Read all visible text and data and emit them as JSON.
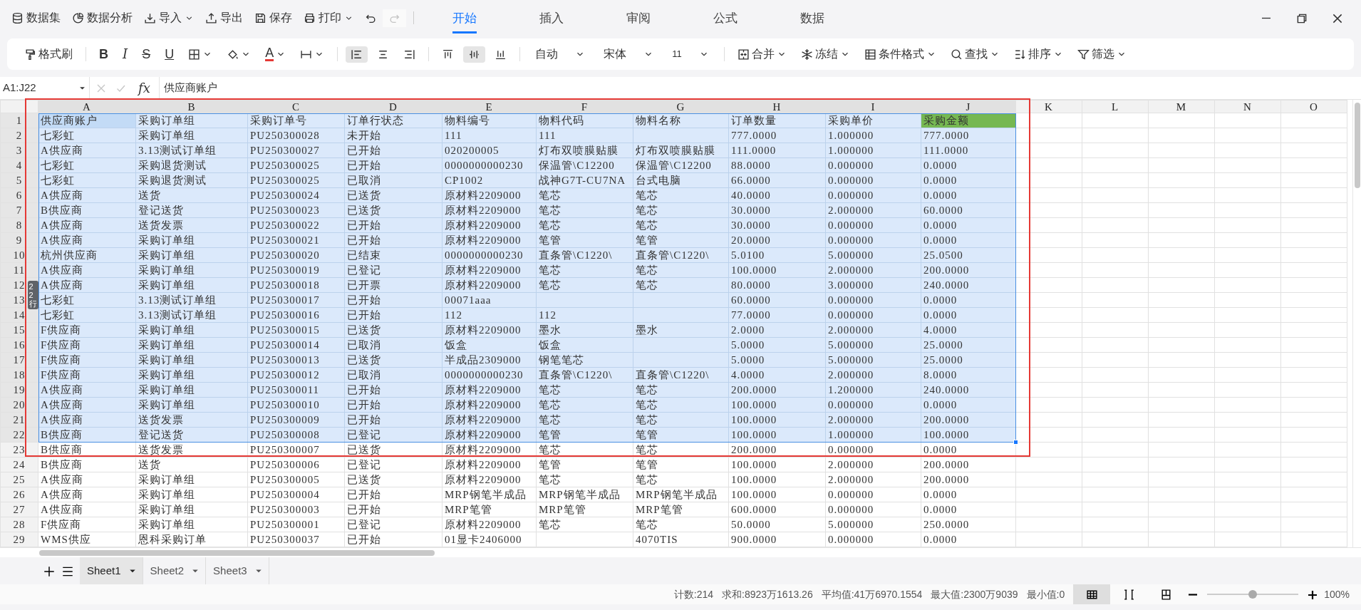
{
  "quick_actions": [
    {
      "kind": "database",
      "label": "数据集",
      "dropdown": false
    },
    {
      "kind": "pie",
      "label": "数据分析",
      "dropdown": false
    },
    {
      "kind": "download",
      "label": "导入",
      "dropdown": true
    },
    {
      "kind": "upload",
      "label": "导出",
      "dropdown": false
    },
    {
      "kind": "save",
      "label": "保存",
      "dropdown": false
    },
    {
      "kind": "print",
      "label": "打印",
      "dropdown": true
    },
    {
      "kind": "undo",
      "disabled": false
    },
    {
      "kind": "redo",
      "disabled": true
    }
  ],
  "tabs": [
    {
      "label": "开始",
      "selected": true
    },
    {
      "label": "插入",
      "selected": false
    },
    {
      "label": "审阅",
      "selected": false
    },
    {
      "label": "公式",
      "selected": false
    },
    {
      "label": "数据",
      "selected": false
    }
  ],
  "toolbar": [
    {
      "kind": "brush",
      "label": "格式刷",
      "dropdown": false,
      "selected": false
    },
    {
      "kind": "separator"
    },
    {
      "kind": "bold",
      "text": "B",
      "dropdown": false,
      "selected": false
    },
    {
      "kind": "italic",
      "text": "I",
      "dropdown": false,
      "selected": false
    },
    {
      "kind": "strike",
      "text": "S",
      "dropdown": false,
      "selected": false
    },
    {
      "kind": "underline",
      "text": "U",
      "dropdown": false,
      "selected": false
    },
    {
      "kind": "border",
      "dropdown": true,
      "selected": false
    },
    {
      "kind": "fill",
      "dropdown": true,
      "selected": false
    },
    {
      "kind": "fontcolor",
      "text": "A",
      "dropdown": true,
      "selected": false
    },
    {
      "kind": "lineheight",
      "dropdown": true,
      "selected": false
    },
    {
      "kind": "separator"
    },
    {
      "kind": "align_left",
      "dropdown": false,
      "selected": true
    },
    {
      "kind": "align_center",
      "dropdown": false,
      "selected": false
    },
    {
      "kind": "align_right",
      "dropdown": false,
      "selected": false
    },
    {
      "kind": "separator"
    },
    {
      "kind": "valign_top",
      "dropdown": false,
      "selected": false
    },
    {
      "kind": "valign_middle",
      "dropdown": false,
      "selected": true
    },
    {
      "kind": "valign_bottom",
      "dropdown": false,
      "selected": false
    },
    {
      "kind": "separator"
    },
    {
      "kind": "select",
      "text": "自动",
      "dropdown": true,
      "selected": false
    },
    {
      "kind": "select",
      "text": "宋体",
      "dropdown": true,
      "selected": false
    },
    {
      "kind": "select",
      "text": "11",
      "dropdown": true,
      "selected": false
    },
    {
      "kind": "separator"
    },
    {
      "kind": "merge",
      "label": "合并",
      "dropdown": true,
      "selected": false
    },
    {
      "kind": "freeze",
      "label": "冻结",
      "dropdown": true,
      "selected": false
    },
    {
      "kind": "conditional",
      "label": "条件格式",
      "dropdown": true,
      "selected": false
    },
    {
      "kind": "find",
      "label": "查找",
      "dropdown": true,
      "selected": false
    },
    {
      "kind": "sort",
      "label": "排序",
      "dropdown": true,
      "selected": false
    },
    {
      "kind": "filter",
      "label": "筛选",
      "dropdown": true,
      "selected": false
    }
  ],
  "formula_bar": {
    "cell_ref": "A1:J22",
    "fx": "fx",
    "formula": "供应商账户"
  },
  "columns": [
    {
      "label": "A",
      "selected": true
    },
    {
      "label": "B",
      "selected": true
    },
    {
      "label": "C",
      "selected": true
    },
    {
      "label": "D",
      "selected": true
    },
    {
      "label": "E",
      "selected": true
    },
    {
      "label": "F",
      "selected": true
    },
    {
      "label": "G",
      "selected": true
    },
    {
      "label": "H",
      "selected": true
    },
    {
      "label": "I",
      "selected": true
    },
    {
      "label": "J",
      "selected": true
    },
    {
      "label": "K",
      "selected": false
    },
    {
      "label": "L",
      "selected": false
    },
    {
      "label": "M",
      "selected": false
    },
    {
      "label": "N",
      "selected": false
    },
    {
      "label": "O",
      "selected": false
    }
  ],
  "rows": [
    {
      "number": "1",
      "selected": true,
      "cells": {
        "A": {
          "text": "供应商账户",
          "active": true
        },
        "B": "采购订单组",
        "C": "采购订单号",
        "D": "订单行状态",
        "E": "物料编号",
        "F": "物料代码",
        "G": "物料名称",
        "H": "订单数量",
        "I": "采购单价",
        "J": {
          "text": "采购金额",
          "color": "#76b852"
        }
      }
    },
    {
      "number": "2",
      "selected": true,
      "cells": {
        "A": "七彩虹",
        "B": "采购订单组",
        "C": "PU250300028",
        "D": "未开始",
        "E": "111",
        "F": "111",
        "H": "777.0000",
        "I": "1.000000",
        "J": "777.0000"
      }
    },
    {
      "number": "3",
      "selected": true,
      "cells": {
        "A": "A供应商",
        "B": "3.13测试订单组",
        "C": "PU250300027",
        "D": "已开始",
        "E": "020200005",
        "F": "灯布双喷膜贴膜",
        "G": "灯布双喷膜贴膜",
        "H": "111.0000",
        "I": "1.000000",
        "J": "111.0000"
      }
    },
    {
      "number": "4",
      "selected": true,
      "cells": {
        "A": "七彩虹",
        "B": "采购退货测试",
        "C": "PU250300025",
        "D": "已开始",
        "E": "0000000000230",
        "F": "保温管\\C12200",
        "G": "保温管\\C12200",
        "H": "88.0000",
        "I": "0.000000",
        "J": "0.0000"
      }
    },
    {
      "number": "5",
      "selected": true,
      "cells": {
        "A": "七彩虹",
        "B": "采购退货测试",
        "C": "PU250300025",
        "D": "已取消",
        "E": "CP1002",
        "F": "战神G7T-CU7NA",
        "G": "台式电脑",
        "H": "66.0000",
        "I": "0.000000",
        "J": "0.0000"
      }
    },
    {
      "number": "6",
      "selected": true,
      "cells": {
        "A": "A供应商",
        "B": "送货",
        "C": "PU250300024",
        "D": "已送货",
        "E": "原材料2209000",
        "F": "笔芯",
        "G": "笔芯",
        "H": "40.0000",
        "I": "0.000000",
        "J": "0.0000"
      }
    },
    {
      "number": "7",
      "selected": true,
      "cells": {
        "A": "B供应商",
        "B": "登记送货",
        "C": "PU250300023",
        "D": "已送货",
        "E": "原材料2209000",
        "F": "笔芯",
        "G": "笔芯",
        "H": "30.0000",
        "I": "2.000000",
        "J": "60.0000"
      }
    },
    {
      "number": "8",
      "selected": true,
      "cells": {
        "A": "A供应商",
        "B": "送货发票",
        "C": "PU250300022",
        "D": "已开始",
        "E": "原材料2209000",
        "F": "笔芯",
        "G": "笔芯",
        "H": "30.0000",
        "I": "0.000000",
        "J": "0.0000"
      }
    },
    {
      "number": "9",
      "selected": true,
      "cells": {
        "A": "A供应商",
        "B": "采购订单组",
        "C": "PU250300021",
        "D": "已开始",
        "E": "原材料2209000",
        "F": "笔管",
        "G": "笔管",
        "H": "20.0000",
        "I": "0.000000",
        "J": "0.0000"
      }
    },
    {
      "number": "10",
      "selected": true,
      "cells": {
        "A": "杭州供应商",
        "B": "采购订单组",
        "C": "PU250300020",
        "D": "已结束",
        "E": "0000000000230",
        "F": "直条管\\C1220\\",
        "G": "直条管\\C1220\\",
        "H": "5.0100",
        "I": "5.000000",
        "J": "25.0500"
      }
    },
    {
      "number": "11",
      "selected": true,
      "cells": {
        "A": "A供应商",
        "B": "采购订单组",
        "C": "PU250300019",
        "D": "已登记",
        "E": "原材料2209000",
        "F": "笔芯",
        "G": "笔芯",
        "H": "100.0000",
        "I": "2.000000",
        "J": "200.0000"
      }
    },
    {
      "number": "12",
      "selected": true,
      "cells": {
        "A": "A供应商",
        "B": "采购订单组",
        "C": "PU250300018",
        "D": "已开票",
        "E": "原材料2209000",
        "F": "笔芯",
        "G": "笔芯",
        "H": "80.0000",
        "I": "3.000000",
        "J": "240.0000"
      }
    },
    {
      "number": "13",
      "selected": true,
      "cells": {
        "A": "七彩虹",
        "B": "3.13测试订单组",
        "C": "PU250300017",
        "D": "已开始",
        "E": "00071aaa",
        "H": "60.0000",
        "I": "0.000000",
        "J": "0.0000"
      }
    },
    {
      "number": "14",
      "selected": true,
      "cells": {
        "A": "七彩虹",
        "B": "3.13测试订单组",
        "C": "PU250300016",
        "D": "已开始",
        "E": "112",
        "F": "112",
        "H": "77.0000",
        "I": "0.000000",
        "J": "0.0000"
      }
    },
    {
      "number": "15",
      "selected": true,
      "cells": {
        "A": "F供应商",
        "B": "采购订单组",
        "C": "PU250300015",
        "D": "已送货",
        "E": "原材料2209000",
        "F": "墨水",
        "G": "墨水",
        "H": "2.0000",
        "I": "2.000000",
        "J": "4.0000"
      }
    },
    {
      "number": "16",
      "selected": true,
      "cells": {
        "A": "F供应商",
        "B": "采购订单组",
        "C": "PU250300014",
        "D": "已取消",
        "E": "饭盒",
        "F": "饭盒",
        "H": "5.0000",
        "I": "5.000000",
        "J": "25.0000"
      }
    },
    {
      "number": "17",
      "selected": true,
      "cells": {
        "A": "F供应商",
        "B": "采购订单组",
        "C": "PU250300013",
        "D": "已送货",
        "E": "半成品2309000",
        "F": "钢笔笔芯",
        "H": "5.0000",
        "I": "5.000000",
        "J": "25.0000"
      }
    },
    {
      "number": "18",
      "selected": true,
      "cells": {
        "A": "F供应商",
        "B": "采购订单组",
        "C": "PU250300012",
        "D": "已取消",
        "E": "0000000000230",
        "F": "直条管\\C1220\\",
        "G": "直条管\\C1220\\",
        "H": "4.0000",
        "I": "2.000000",
        "J": "8.0000"
      }
    },
    {
      "number": "19",
      "selected": true,
      "cells": {
        "A": "A供应商",
        "B": "采购订单组",
        "C": "PU250300011",
        "D": "已开始",
        "E": "原材料2209000",
        "F": "笔芯",
        "G": "笔芯",
        "H": "200.0000",
        "I": "1.200000",
        "J": "240.0000"
      }
    },
    {
      "number": "20",
      "selected": true,
      "cells": {
        "A": "A供应商",
        "B": "采购订单组",
        "C": "PU250300010",
        "D": "已开始",
        "E": "原材料2209000",
        "F": "笔芯",
        "G": "笔芯",
        "H": "100.0000",
        "I": "0.000000",
        "J": "0.0000"
      }
    },
    {
      "number": "21",
      "selected": true,
      "cells": {
        "A": "A供应商",
        "B": "送货发票",
        "C": "PU250300009",
        "D": "已开始",
        "E": "原材料2209000",
        "F": "笔芯",
        "G": "笔芯",
        "H": "100.0000",
        "I": "2.000000",
        "J": "200.0000"
      }
    },
    {
      "number": "22",
      "selected": true,
      "cells": {
        "A": "B供应商",
        "B": "登记送货",
        "C": "PU250300008",
        "D": "已登记",
        "E": "原材料2209000",
        "F": "笔管",
        "G": "笔管",
        "H": "100.0000",
        "I": "1.000000",
        "J": "100.0000"
      }
    },
    {
      "number": "23",
      "selected": false,
      "cells": {
        "A": "B供应商",
        "B": "送货发票",
        "C": "PU250300007",
        "D": "已送货",
        "E": "原材料2209000",
        "F": "笔芯",
        "G": "笔芯",
        "H": "200.0000",
        "I": "0.000000",
        "J": "0.0000"
      }
    },
    {
      "number": "24",
      "selected": false,
      "cells": {
        "A": "B供应商",
        "B": "送货",
        "C": "PU250300006",
        "D": "已登记",
        "E": "原材料2209000",
        "F": "笔管",
        "G": "笔管",
        "H": "100.0000",
        "I": "2.000000",
        "J": "200.0000"
      }
    },
    {
      "number": "25",
      "selected": false,
      "cells": {
        "A": "A供应商",
        "B": "采购订单组",
        "C": "PU250300005",
        "D": "已送货",
        "E": "原材料2209000",
        "F": "笔芯",
        "G": "笔芯",
        "H": "100.0000",
        "I": "2.000000",
        "J": "200.0000"
      }
    },
    {
      "number": "26",
      "selected": false,
      "cells": {
        "A": "A供应商",
        "B": "采购订单组",
        "C": "PU250300004",
        "D": "已开始",
        "E": "MRP钢笔半成品",
        "F": "MRP钢笔半成品",
        "G": "MRP钢笔半成品",
        "H": "100.0000",
        "I": "0.000000",
        "J": "0.0000"
      }
    },
    {
      "number": "27",
      "selected": false,
      "cells": {
        "A": "A供应商",
        "B": "采购订单组",
        "C": "PU250300003",
        "D": "已开始",
        "E": "MRP笔管",
        "F": "MRP笔管",
        "G": "MRP笔管",
        "H": "600.0000",
        "I": "0.000000",
        "J": "0.0000"
      }
    },
    {
      "number": "28",
      "selected": false,
      "cells": {
        "A": "F供应商",
        "B": "采购订单组",
        "C": "PU250300001",
        "D": "已登记",
        "E": "原材料2209000",
        "F": "笔芯",
        "G": "笔芯",
        "H": "50.0000",
        "I": "5.000000",
        "J": "250.0000"
      }
    },
    {
      "number": "29",
      "selected": false,
      "cells": {
        "A": "WMS供应",
        "B": "恩科采购订单",
        "C": "PU250300037",
        "D": "已开始",
        "E": "01显卡2406000",
        "G": "4070TIS",
        "H": "900.0000",
        "I": "0.000000",
        "J": "0.0000"
      }
    }
  ],
  "selection_badge": "22行",
  "annotation": {
    "kind": "rectangle",
    "color": "#e53935"
  },
  "sheets": [
    {
      "label": "Sheet1",
      "selected": true
    },
    {
      "label": "Sheet2",
      "selected": false
    },
    {
      "label": "Sheet3",
      "selected": false
    }
  ],
  "status_bar": {
    "stats": [
      "计数:214",
      "求和:8923万1613.26",
      "平均值:41万6970.1554",
      "最大值:2300万9039",
      "最小值:0"
    ],
    "views": [
      {
        "kind": "normal",
        "selected": true
      },
      {
        "kind": "page_break",
        "selected": false
      },
      {
        "kind": "page_layout",
        "selected": false
      }
    ],
    "zoom": {
      "level": 0.5,
      "reading": "100%"
    }
  }
}
